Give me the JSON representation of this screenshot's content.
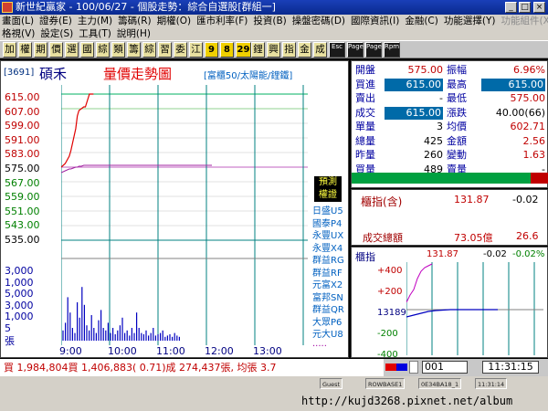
{
  "window": {
    "title": "新世紀贏家 - 100/06/27 - 個股走勢：綜合自選股[群組一]",
    "buttons": [
      "_",
      "□",
      "×"
    ]
  },
  "menu": {
    "row1": [
      "畫面(L)",
      "證券(E)",
      "主力(M)",
      "籌碼(R)",
      "期權(O)",
      "匯市利率(F)",
      "投資(B)",
      "操盤密碼(D)",
      "國際資訊(I)",
      "金融(C)",
      "功能選擇(Y)",
      "功能組件(X)"
    ],
    "row1_disabled": [
      false,
      false,
      false,
      false,
      false,
      false,
      false,
      false,
      false,
      false,
      false,
      true
    ],
    "row2": [
      "格視(V)",
      "設定(S)",
      "工具(T)",
      "說明(H)"
    ]
  },
  "toolbar": {
    "buttons": [
      "加",
      "權",
      "期",
      "價",
      "選",
      "國",
      "綜",
      "類",
      "籌",
      "綜",
      "習",
      "委",
      "江",
      "9",
      "8",
      "29",
      "鋰",
      "興",
      "指",
      "金",
      "成",
      "Esc",
      "Page",
      "Page",
      "Rpm"
    ]
  },
  "stock": {
    "code": "[3691]",
    "name": "碩禾",
    "chart_title": "量價走勢圖",
    "tags": "[富櫃50/太陽能/鋰鐵]"
  },
  "price_axis": [
    "615.00",
    "607.00",
    "599.00",
    "591.00",
    "583.00",
    "575.00",
    "567.00",
    "559.00",
    "551.00",
    "543.00",
    "535.00"
  ],
  "volume_axis": [
    "3,000",
    "1,000",
    "5,000",
    "3,000",
    "1,000",
    "5",
    "張"
  ],
  "time_axis": [
    "9:00",
    "10:00",
    "11:00",
    "12:00",
    "13:00"
  ],
  "side_buttons": [
    "預測",
    "權證"
  ],
  "warrants": [
    "日盛U5",
    "國泰P4",
    "永豐UX",
    "永豐X4",
    "群益RG",
    "群益RF",
    "元富X2",
    "富邦SN",
    "群益QR",
    "大眾P6",
    "元大U8",
    "....."
  ],
  "quote": {
    "rows": [
      {
        "k1": "開盤",
        "v1": "575.00",
        "k2": "振幅",
        "v2": "6.96%"
      },
      {
        "k1": "買進",
        "v1": "615.00",
        "k2": "最高",
        "v2": "615.00"
      },
      {
        "k1": "賣出",
        "v1": "-",
        "k2": "最低",
        "v2": "575.00"
      },
      {
        "k1": "成交",
        "v1": "615.00",
        "k2": "漲跌",
        "v2": "40.00(66)"
      },
      {
        "k1": "單量",
        "v1": "3",
        "k2": "均價",
        "v2": "602.71"
      },
      {
        "k1": "總量",
        "v1": "425",
        "k2": "金額",
        "v2": "2.56"
      },
      {
        "k1": "昨量",
        "v1": "260",
        "k2": "變動",
        "v2": "1.63"
      },
      {
        "k1": "買量",
        "v1": "489",
        "k2": "賣量",
        "v2": "-"
      }
    ]
  },
  "index_panel": {
    "label": "櫃指(含)",
    "value": "131.87",
    "change": "-0.02",
    "turnover_label": "成交總額",
    "turnover": "73.05億",
    "turnover_ratio": "26.6"
  },
  "trend_panel": {
    "label": "櫃指",
    "value": "131.87",
    "change": "-0.02",
    "pct": "-0.02%",
    "axis": [
      "+400",
      "+200",
      "13189",
      "-200",
      "-400"
    ]
  },
  "status": {
    "text": "買 1,984,804買 1,406,883( 0.71)成 274,437張, 均張 3.7",
    "code_box": "001",
    "time": "11:31:15"
  },
  "statusbar": {
    "fields": [
      "Guest",
      "ROWBASE1",
      "0E34BA18_1",
      "11:31:14"
    ]
  },
  "footer_url": "http://kujd3268.pixnet.net/album",
  "chart_data": {
    "type": "line",
    "title": "量價走勢圖",
    "x": [
      "09:00",
      "09:05",
      "09:10",
      "09:12",
      "09:15",
      "09:18",
      "09:20",
      "09:22",
      "09:25",
      "09:28",
      "09:30",
      "09:35",
      "09:40"
    ],
    "series": [
      {
        "values": [
          575,
          577,
          581,
          584,
          590,
          596,
          603,
          606,
          607,
          608,
          608,
          615,
          615
        ]
      },
      {
        "values": [
          572,
          573,
          574,
          574,
          574.5,
          575,
          575,
          575.5,
          575.5,
          576,
          576,
          576,
          576
        ]
      }
    ],
    "ylim": [
      535,
      615
    ],
    "colors": {
      "price": "#e00000",
      "average": "#a020a0",
      "volume": "#0000c0",
      "up": "#e00000",
      "down": "#008000",
      "accent": "#006aa8"
    }
  }
}
